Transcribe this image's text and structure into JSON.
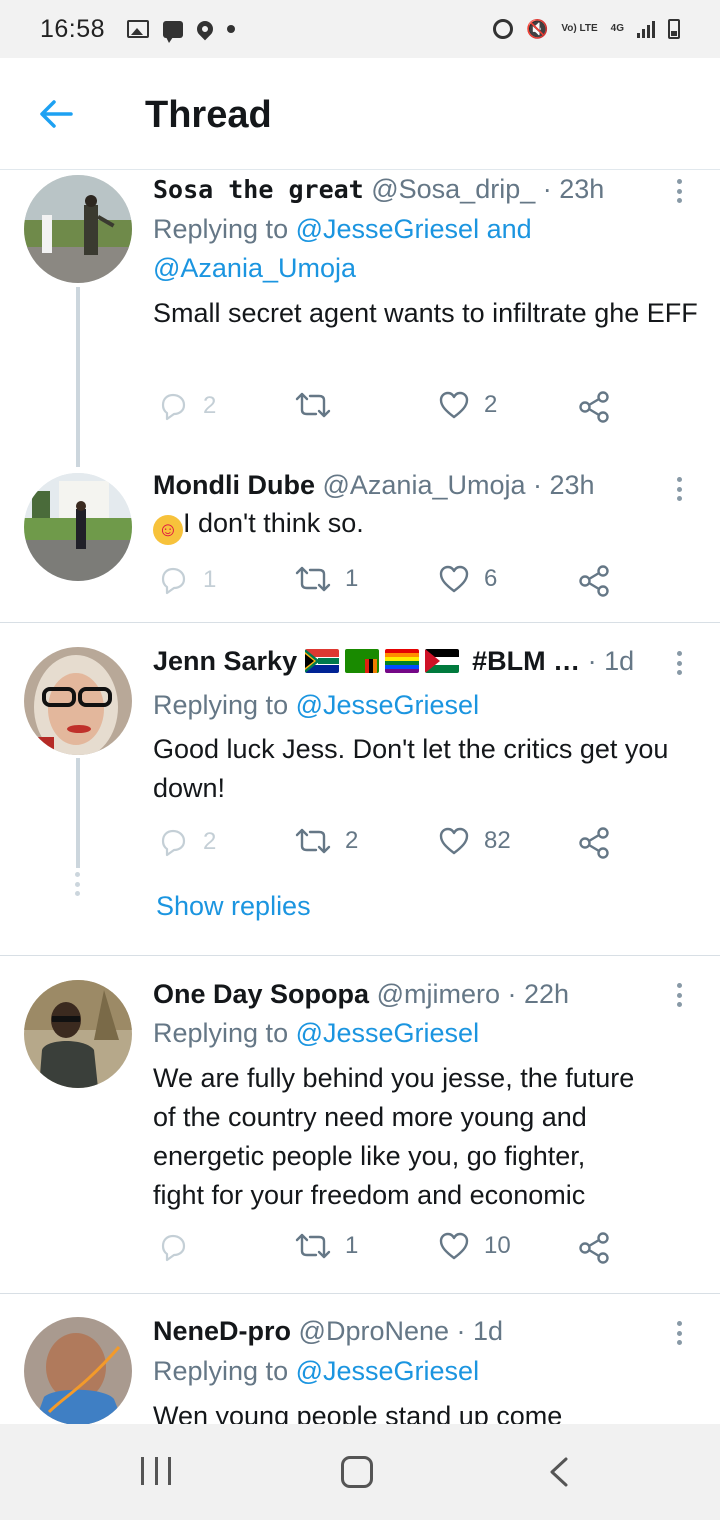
{
  "status_bar": {
    "time": "16:58",
    "icons_left": [
      "image-icon",
      "message-icon",
      "location-icon",
      "dot-icon"
    ],
    "icons_right": [
      "alarm-icon",
      "mute-icon",
      "volte-icon",
      "4g-icon",
      "signal-icon",
      "battery-icon"
    ],
    "volte_label": "Vo) LTE",
    "network_label": "4G"
  },
  "header": {
    "title": "Thread",
    "accent_color": "#1da1f2"
  },
  "tweets": [
    {
      "name": "Sosa the great",
      "handle": "@Sosa_drip_",
      "time": "· 23h",
      "replying_prefix": "Replying to",
      "replying_line1_mention": "@JesseGriesel",
      "replying_and": "and",
      "replying_line2_mention": "@Azania_Umoja",
      "text": "Small secret agent wants to infiltrate ghe EFF",
      "replies": "2",
      "retweets": "",
      "likes": "2"
    },
    {
      "name": "Mondli Dube",
      "handle": "@Azania_Umoja",
      "time": "· 23h",
      "text_emoji": "☺",
      "text": "I don't think so.",
      "replies": "1",
      "retweets": "1",
      "likes": "6"
    },
    {
      "name": "Jenn Sarky",
      "name_suffix": "#BLM …",
      "time": "· 1d",
      "replying_prefix": "Replying to",
      "replying_mention": "@JesseGriesel",
      "text": "Good luck Jess. Don't let the critics get you down!",
      "replies": "2",
      "retweets": "2",
      "likes": "82",
      "show_replies": "Show replies"
    },
    {
      "name": "One Day Sopopa",
      "handle": "@mjimero",
      "time": "· 22h",
      "replying_prefix": "Replying to",
      "replying_mention": "@JesseGriesel",
      "text_lines": [
        "We are fully behind you jesse,  the future",
        "of the country need more young and",
        "energetic people like you,  go fighter,",
        "fight for your freedom and economic"
      ],
      "replies": "",
      "retweets": "1",
      "likes": "10"
    },
    {
      "name": "NeneD-pro",
      "handle": "@DproNene",
      "time": "· 1d",
      "replying_prefix": "Replying to",
      "replying_mention": "@JesseGriesel",
      "text": "Wen young people stand up come"
    }
  ],
  "colors": {
    "link": "#1b95e0",
    "secondary_text": "#657786",
    "thread_line": "#ccd6dd"
  }
}
